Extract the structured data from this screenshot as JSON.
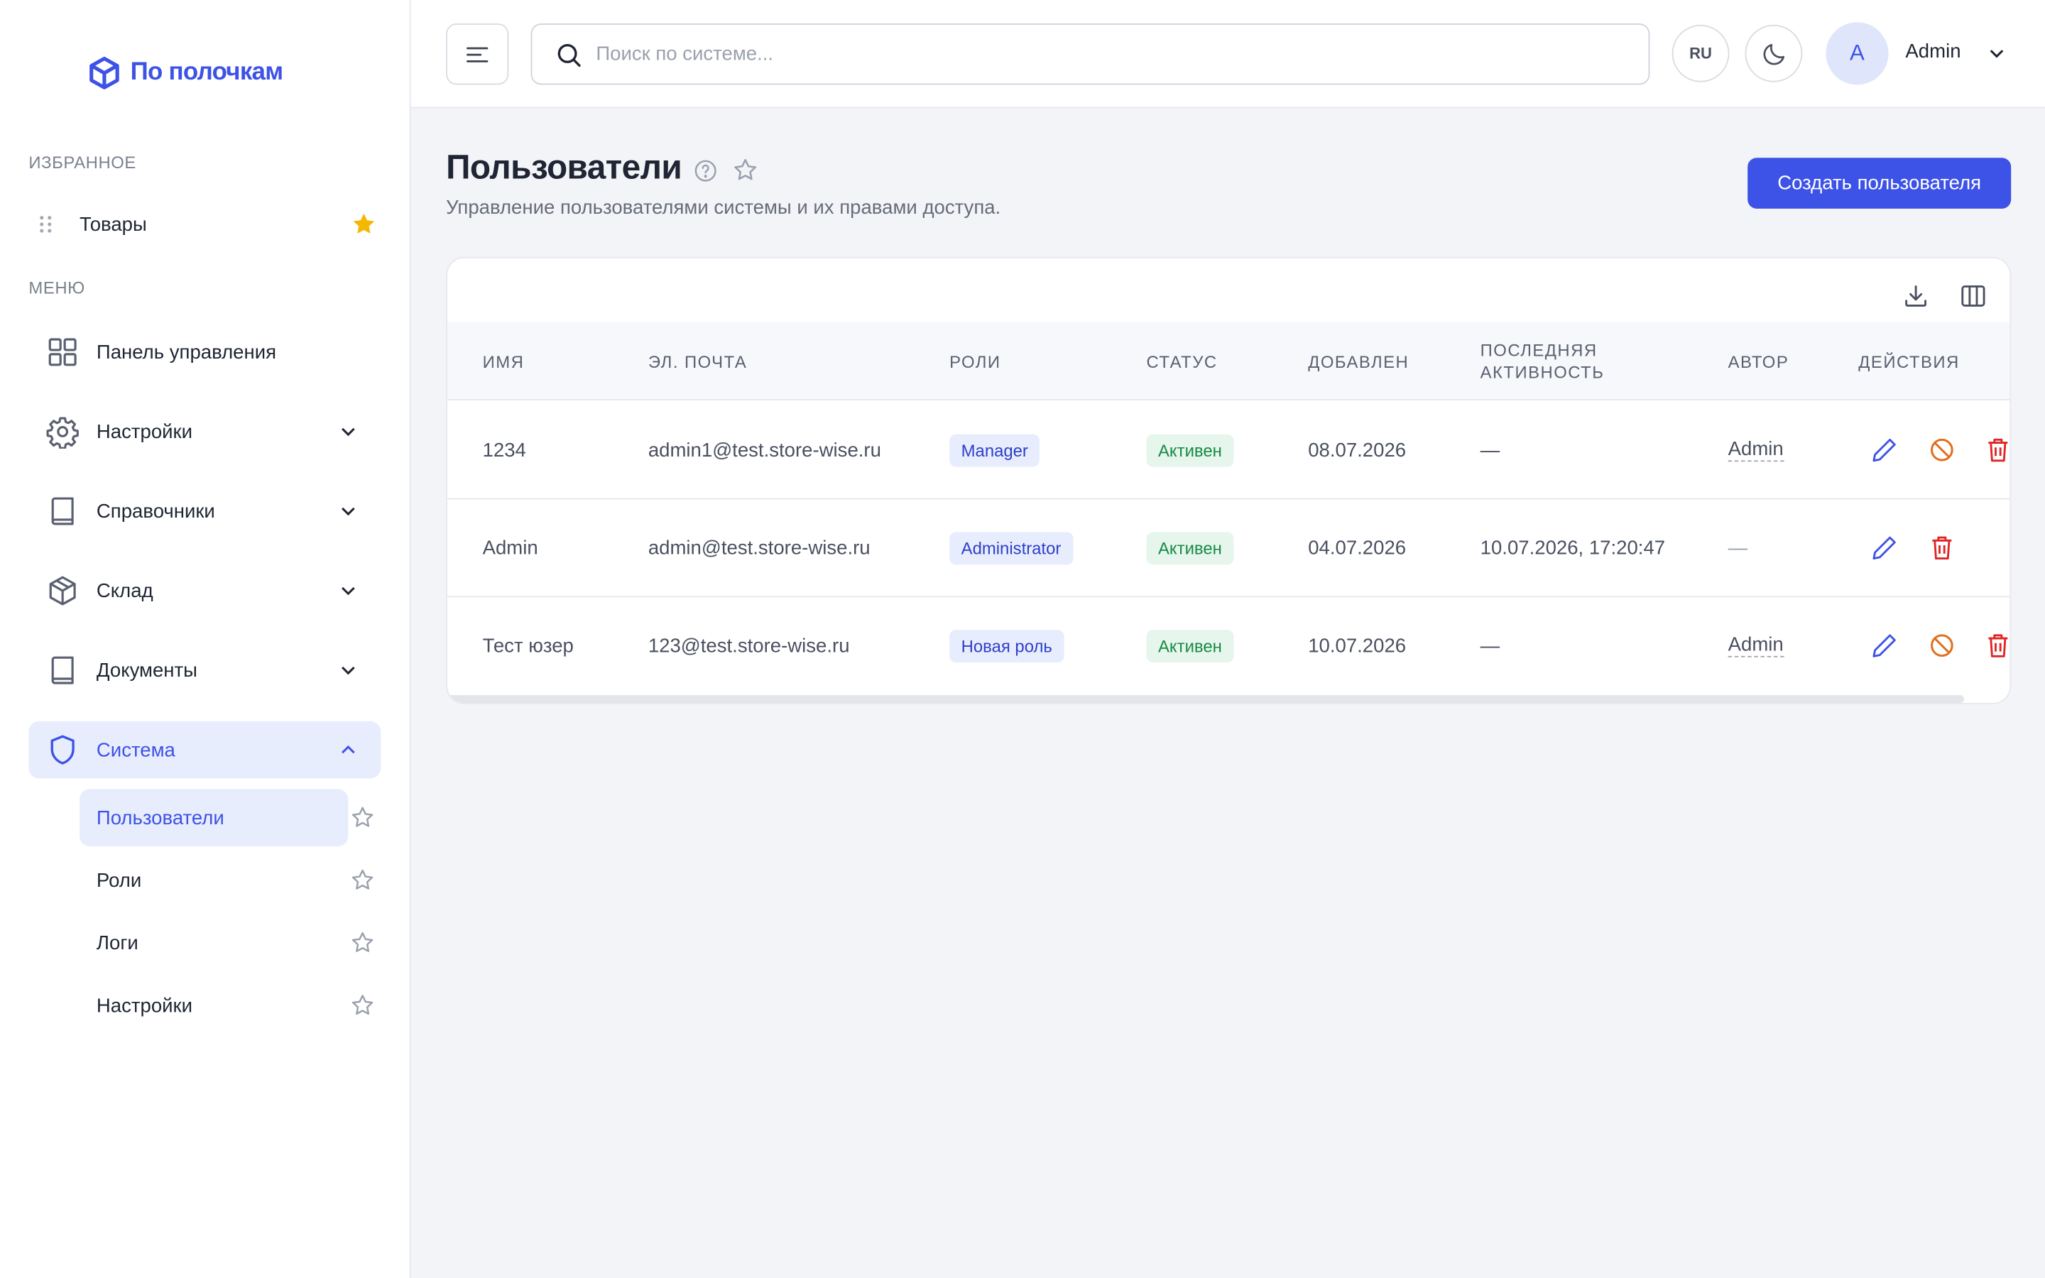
{
  "app": {
    "logo_text": "По полочкам"
  },
  "sidebar": {
    "favorites_label": "ИЗБРАННОЕ",
    "favorites": [
      {
        "label": "Товары"
      }
    ],
    "menu_label": "МЕНЮ",
    "items": [
      {
        "label": "Панель управления"
      },
      {
        "label": "Настройки"
      },
      {
        "label": "Справочники"
      },
      {
        "label": "Склад"
      },
      {
        "label": "Документы"
      },
      {
        "label": "Система"
      }
    ],
    "system_sub": [
      {
        "label": "Пользователи"
      },
      {
        "label": "Роли"
      },
      {
        "label": "Логи"
      },
      {
        "label": "Настройки"
      }
    ]
  },
  "header": {
    "search_placeholder": "Поиск по системе...",
    "lang": "RU",
    "avatar_letter": "A",
    "user_name": "Admin"
  },
  "page": {
    "title": "Пользователи",
    "subtitle": "Управление пользователями системы и их правами доступа.",
    "create_button": "Создать пользователя"
  },
  "table": {
    "columns": [
      "Имя",
      "Эл. почта",
      "Роли",
      "Статус",
      "Добавлен",
      "Последняя активность",
      "Автор",
      "Действия"
    ],
    "rows": [
      {
        "name": "1234",
        "email": "admin1@test.store-wise.ru",
        "role": "Manager",
        "status": "Активен",
        "added": "08.07.2026",
        "last_active": "—",
        "author": "Admin"
      },
      {
        "name": "Admin",
        "email": "admin@test.store-wise.ru",
        "role": "Administrator",
        "status": "Активен",
        "added": "04.07.2026",
        "last_active": "10.07.2026, 17:20:47",
        "author": "—"
      },
      {
        "name": "Тест юзер",
        "email": "123@test.store-wise.ru",
        "role": "Новая роль",
        "status": "Активен",
        "added": "10.07.2026",
        "last_active": "—",
        "author": "Admin"
      }
    ]
  },
  "colors": {
    "accent": "#3d52e6",
    "active_bg": "#e8edfd",
    "success": "#178a45",
    "warning": "#e0701f",
    "danger": "#e02424",
    "star_fav": "#f5b800"
  }
}
